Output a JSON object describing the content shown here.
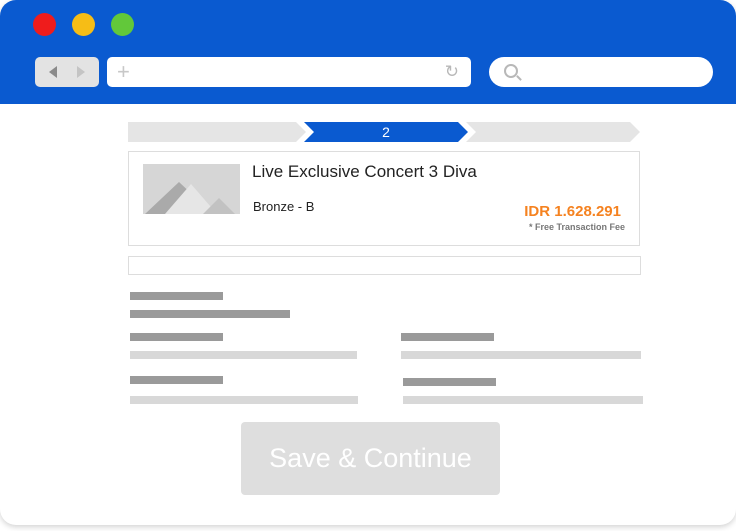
{
  "browser": {
    "window_controls": [
      "close",
      "minimize",
      "maximize"
    ],
    "nav": {
      "back_icon": "chevron-left-icon",
      "forward_icon": "chevron-right-icon"
    },
    "address": {
      "new_tab_glyph": "+",
      "reload_glyph": "↻",
      "url": ""
    },
    "search": {
      "icon": "search-icon",
      "placeholder": ""
    }
  },
  "stepper": {
    "active_step": "2",
    "total_steps": 3,
    "active_index": 1
  },
  "event": {
    "title": "Live Exclusive Concert 3 Diva",
    "variant": "Bronze - B",
    "price": "IDR 1.628.291",
    "fee_note": "* Free Transaction Fee"
  },
  "actions": {
    "save_label": "Save & Continue"
  },
  "colors": {
    "titlebar": "#0a5ad0",
    "step_active": "#0a5ad0",
    "step_inactive": "#e5e5e5",
    "price": "#f58220",
    "button_disabled": "#dedede"
  }
}
